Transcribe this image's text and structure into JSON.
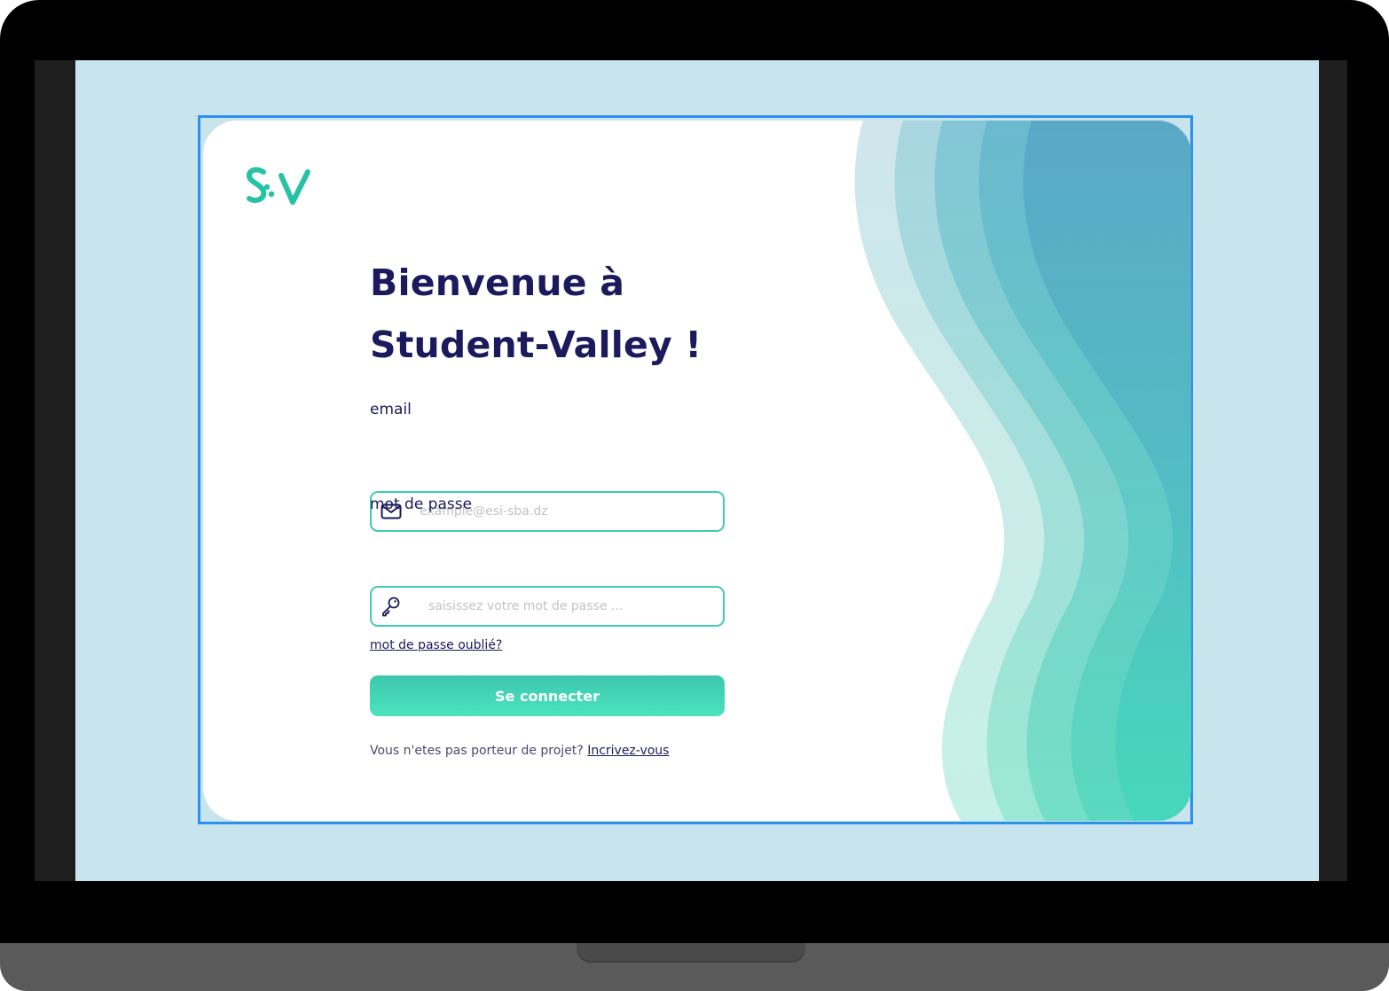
{
  "login": {
    "title_line1": "Bienvenue à",
    "title_line2": "Student-Valley !",
    "email_label": "email",
    "email_placeholder": "example@esi-sba.dz",
    "password_label": "mot de passe",
    "password_placeholder": "saisissez votre mot de passe ...",
    "forgot_link": "mot de passe oublié?",
    "submit_label": "Se connecter",
    "signup_prompt": "Vous n'etes pas porteur de projet?",
    "signup_link": "Incrivez-vous"
  },
  "logo": {
    "text": "SV",
    "color": "#26c2a4"
  },
  "colors": {
    "accent": "#3ecdb1",
    "title": "#1b1a5c",
    "screen_bg": "#c8e4ec",
    "selection": "#2d8ff0"
  },
  "icons": {
    "email": "mail-icon",
    "password": "key-icon"
  }
}
